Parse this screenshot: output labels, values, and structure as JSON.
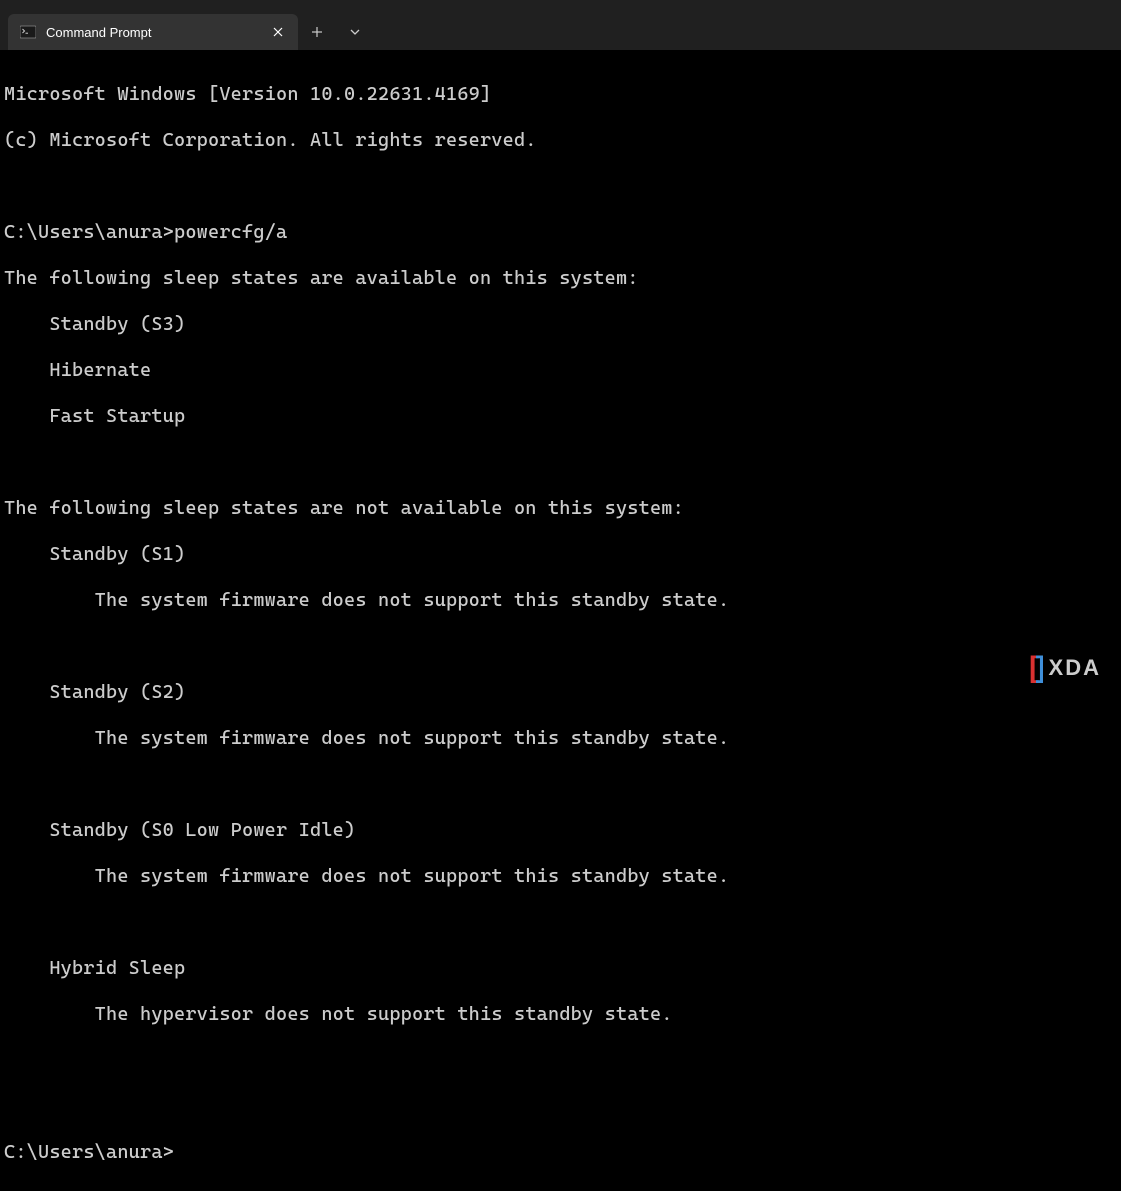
{
  "tab": {
    "title": "Command Prompt"
  },
  "terminal": {
    "header_line1": "Microsoft Windows [Version 10.0.22631.4169]",
    "header_line2": "(c) Microsoft Corporation. All rights reserved.",
    "prompt1": "C:\\Users\\anura>",
    "command1": "powercfg/a",
    "available_heading": "The following sleep states are available on this system:",
    "available_states": [
      "Standby (S3)",
      "Hibernate",
      "Fast Startup"
    ],
    "unavailable_heading": "The following sleep states are not available on this system:",
    "unavailable": [
      {
        "state": "Standby (S1)",
        "reason": "The system firmware does not support this standby state."
      },
      {
        "state": "Standby (S2)",
        "reason": "The system firmware does not support this standby state."
      },
      {
        "state": "Standby (S0 Low Power Idle)",
        "reason": "The system firmware does not support this standby state."
      },
      {
        "state": "Hybrid Sleep",
        "reason": "The hypervisor does not support this standby state."
      }
    ],
    "prompt2": "C:\\Users\\anura>"
  },
  "watermark": {
    "brand": "XDA"
  }
}
